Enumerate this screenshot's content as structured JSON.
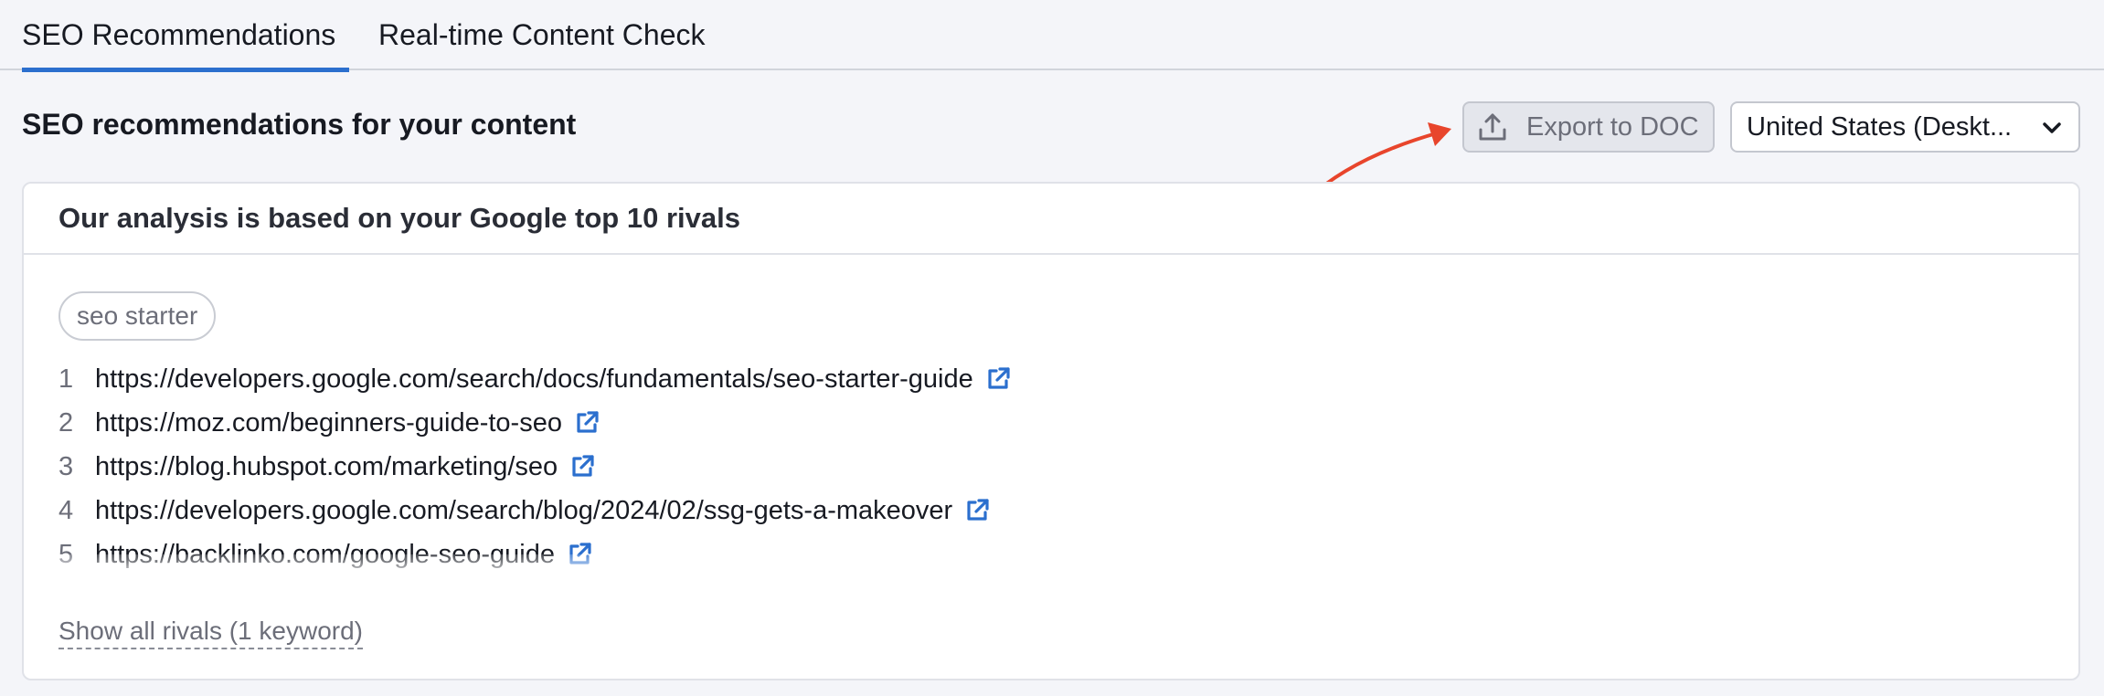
{
  "tabs": [
    {
      "label": "SEO Recommendations",
      "active": true
    },
    {
      "label": "Real-time Content Check",
      "active": false
    }
  ],
  "header": {
    "title": "SEO recommendations for your content",
    "export_label": "Export to DOC",
    "region_value": "United States (Deskt..."
  },
  "card": {
    "title": "Our analysis is based on your Google top 10 rivals",
    "keyword": "seo starter",
    "rivals": [
      {
        "num": "1",
        "url": "https://developers.google.com/search/docs/fundamentals/seo-starter-guide"
      },
      {
        "num": "2",
        "url": "https://moz.com/beginners-guide-to-seo"
      },
      {
        "num": "3",
        "url": "https://blog.hubspot.com/marketing/seo"
      },
      {
        "num": "4",
        "url": "https://developers.google.com/search/blog/2024/02/ssg-gets-a-makeover"
      },
      {
        "num": "5",
        "url": "https://backlinko.com/google-seo-guide"
      }
    ],
    "show_all_label": "Show all rivals (1 keyword)"
  },
  "colors": {
    "accent": "#2b6fce",
    "annotation": "#e8452c",
    "background": "#f4f5f9"
  }
}
